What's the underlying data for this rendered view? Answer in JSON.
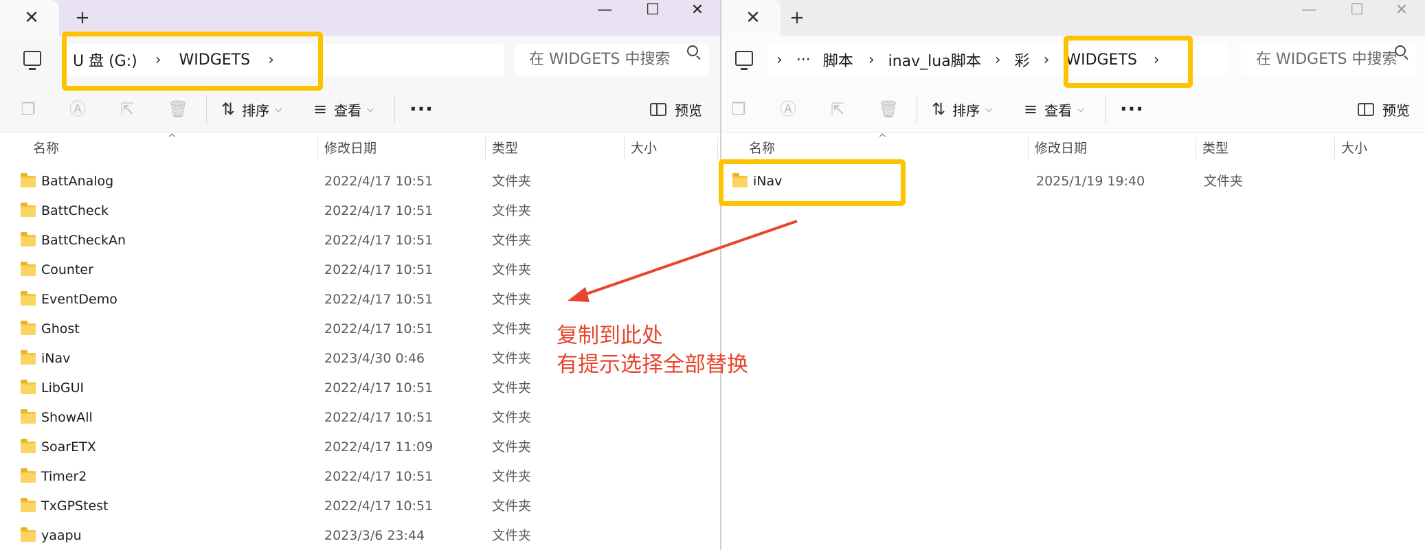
{
  "left": {
    "tab": {
      "close_glyph": "✕"
    },
    "new_tab_glyph": "+",
    "window_controls": {
      "minimize": "—",
      "maximize": "☐",
      "close": "✕"
    },
    "breadcrumb": [
      "U 盘 (G:)",
      "WIDGETS"
    ],
    "search_placeholder": "在 WIDGETS 中搜索",
    "toolbar": {
      "sort": "排序",
      "view": "查看",
      "more": "···",
      "preview": "预览"
    },
    "columns": {
      "name": "名称",
      "date": "修改日期",
      "type": "类型",
      "size": "大小"
    },
    "rows": [
      {
        "name": "BattAnalog",
        "date": "2022/4/17 10:51",
        "type": "文件夹"
      },
      {
        "name": "BattCheck",
        "date": "2022/4/17 10:51",
        "type": "文件夹"
      },
      {
        "name": "BattCheckAn",
        "date": "2022/4/17 10:51",
        "type": "文件夹"
      },
      {
        "name": "Counter",
        "date": "2022/4/17 10:51",
        "type": "文件夹"
      },
      {
        "name": "EventDemo",
        "date": "2022/4/17 10:51",
        "type": "文件夹"
      },
      {
        "name": "Ghost",
        "date": "2022/4/17 10:51",
        "type": "文件夹"
      },
      {
        "name": "iNav",
        "date": "2023/4/30 0:46",
        "type": "文件夹"
      },
      {
        "name": "LibGUI",
        "date": "2022/4/17 10:51",
        "type": "文件夹"
      },
      {
        "name": "ShowAll",
        "date": "2022/4/17 10:51",
        "type": "文件夹"
      },
      {
        "name": "SoarETX",
        "date": "2022/4/17 11:09",
        "type": "文件夹"
      },
      {
        "name": "Timer2",
        "date": "2022/4/17 10:51",
        "type": "文件夹"
      },
      {
        "name": "TxGPStest",
        "date": "2022/4/17 10:51",
        "type": "文件夹"
      },
      {
        "name": "yaapu",
        "date": "2023/3/6 23:44",
        "type": "文件夹"
      }
    ]
  },
  "right": {
    "tab": {
      "close_glyph": "✕"
    },
    "new_tab_glyph": "+",
    "window_controls": {
      "minimize": "—",
      "maximize": "☐",
      "close": "✕"
    },
    "breadcrumb_more": "···",
    "breadcrumb": [
      "脚本",
      "inav_lua脚本",
      "彩",
      "WIDGETS"
    ],
    "search_placeholder": "在 WIDGETS 中搜索",
    "toolbar": {
      "sort": "排序",
      "view": "查看",
      "more": "···",
      "preview": "预览"
    },
    "columns": {
      "name": "名称",
      "date": "修改日期",
      "type": "类型",
      "size": "大小"
    },
    "rows": [
      {
        "name": "iNav",
        "date": "2025/1/19 19:40",
        "type": "文件夹"
      }
    ]
  },
  "annotation": {
    "line1": "复制到此处",
    "line2": "有提示选择全部替换",
    "highlight_color": "#fdc300",
    "text_color": "#e7452e"
  },
  "icons": {
    "pc": "this-pc-icon",
    "copy": "copy-icon",
    "rename": "rename-icon",
    "share": "share-icon",
    "delete": "delete-icon",
    "sort": "sort-icon",
    "view": "view-icon",
    "preview": "preview-pane-icon",
    "folder": "folder-icon",
    "search": "search-icon"
  }
}
